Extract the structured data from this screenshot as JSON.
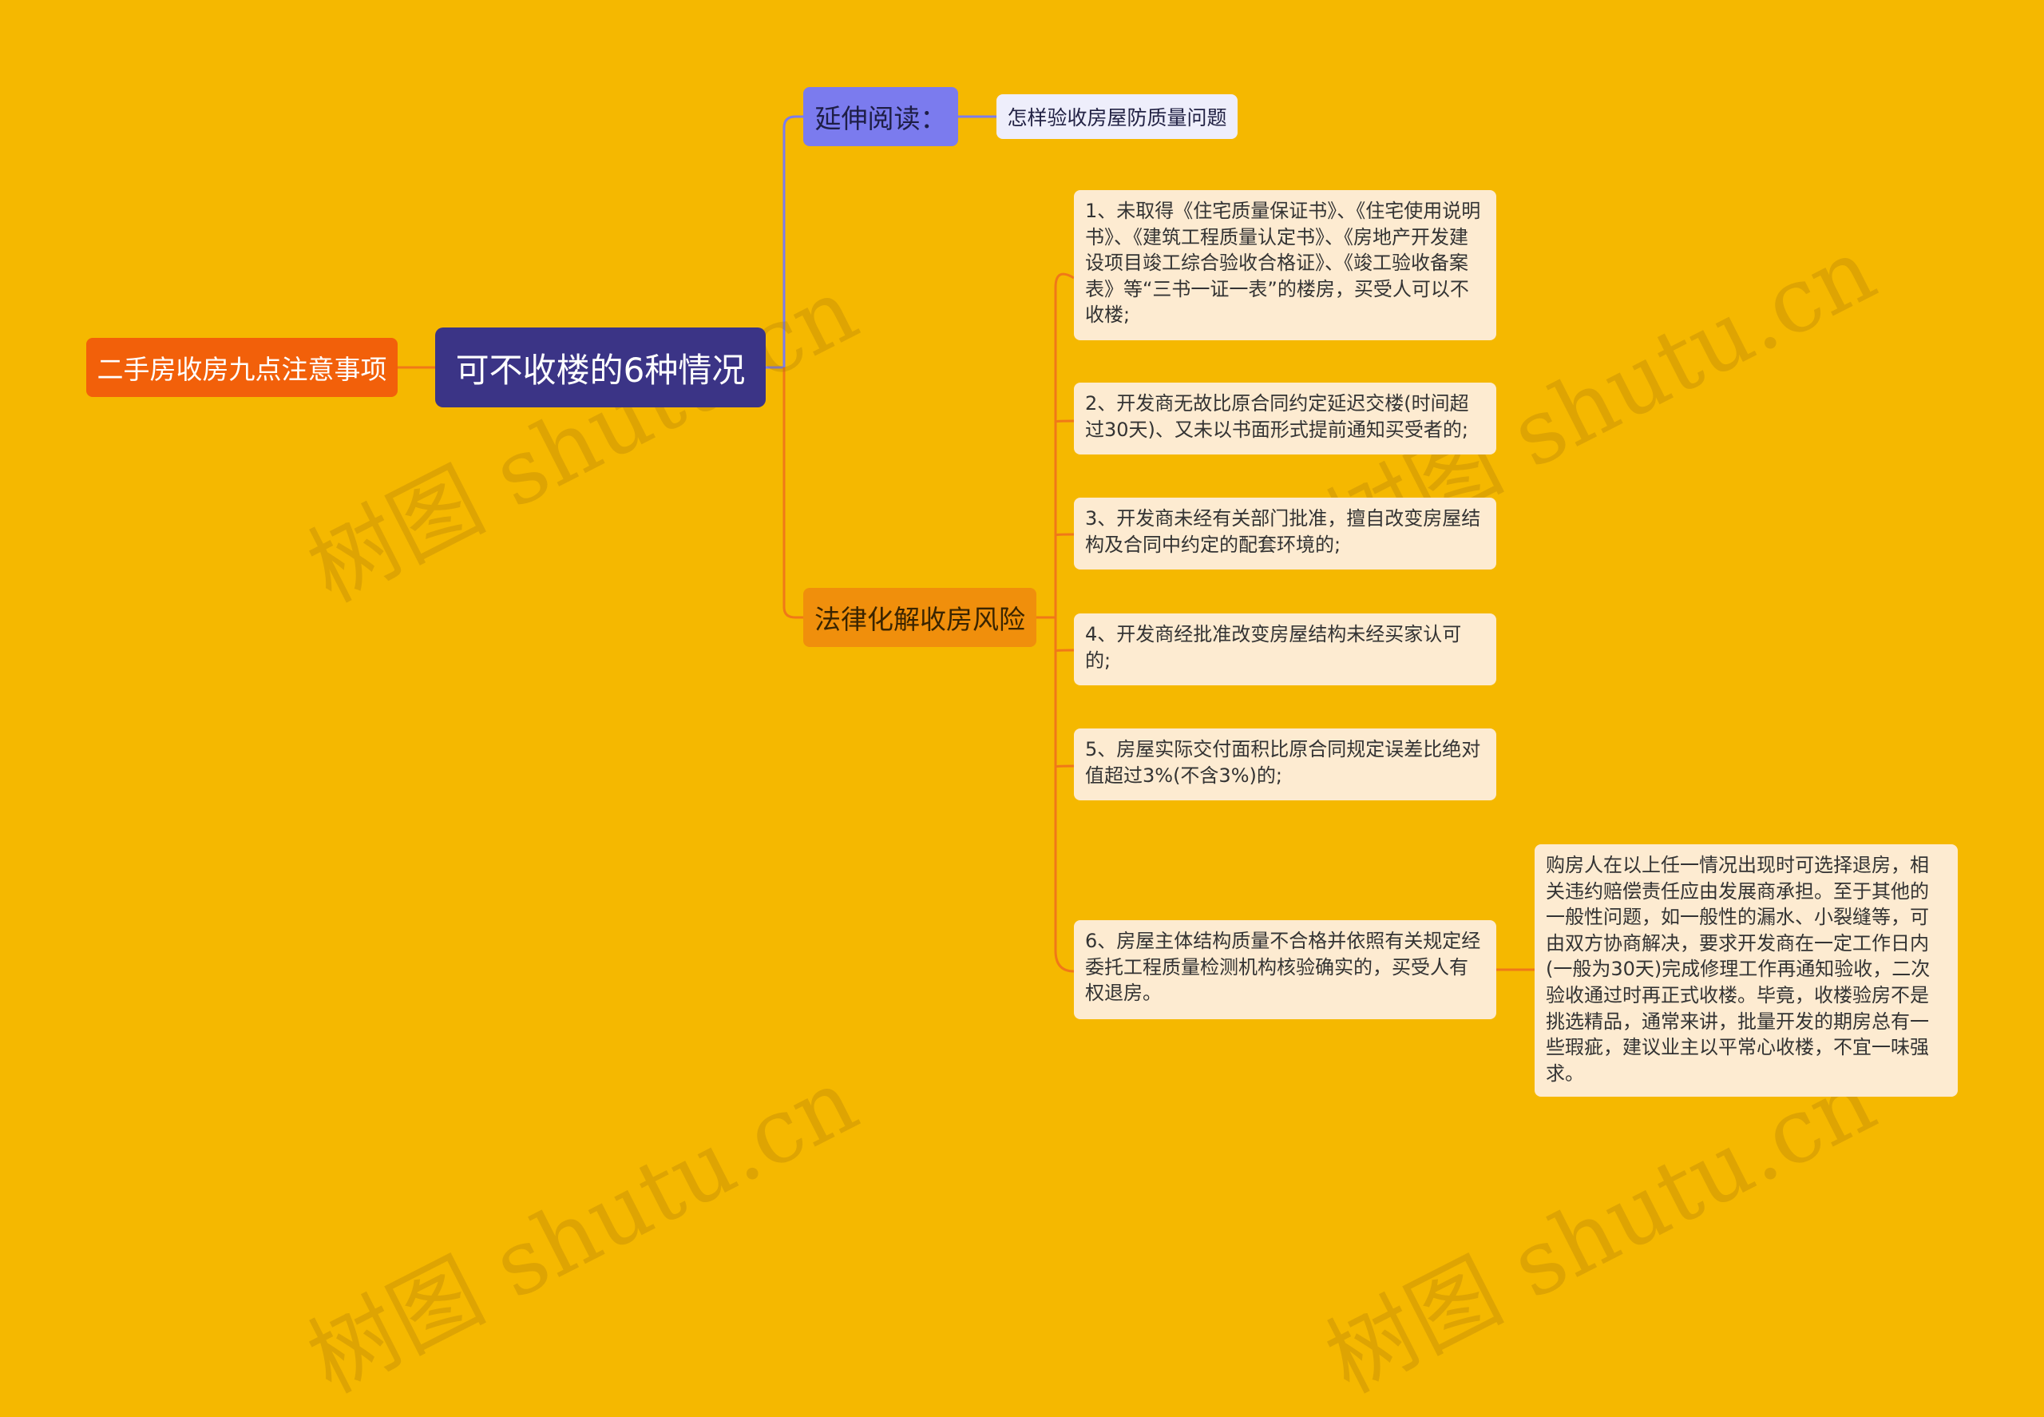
{
  "left_topic": "二手房收房九点注意事项",
  "root_topic": "可不收楼的6种情况",
  "branches": {
    "extended_reading": {
      "label": "延伸阅读：",
      "item": "怎样验收房屋防质量问题"
    },
    "legal": {
      "label": "法律化解收房风险",
      "items": [
        "1、未取得《住宅质量保证书》、《住宅使用说明书》、《建筑工程质量认定书》、《房地产开发建设项目竣工综合验收合格证》、《竣工验收备案表》等“三书一证一表”的楼房，买受人可以不收楼;",
        "2、开发商无故比原合同约定延迟交楼(时间超过30天)、又未以书面形式提前通知买受者的;",
        "3、开发商未经有关部门批准，擅自改变房屋结构及合同中约定的配套环境的;",
        "4、开发商经批准改变房屋结构未经买家认可的;",
        "5、房屋实际交付面积比原合同规定误差比绝对值超过3%(不含3%)的;",
        "6、房屋主体结构质量不合格并依照有关规定经委托工程质量检测机构核验确实的，买受人有权退房。"
      ],
      "note": "购房人在以上任一情况出现时可选择退房，相关违约赔偿责任应由发展商承担。至于其他的一般性问题，如一般性的漏水、小裂缝等，可由双方协商解决，要求开发商在一定工作日内(一般为30天)完成修理工作再通知验收，二次验收通过时再正式收楼。毕竟，收楼验房不是挑选精品，通常来讲，批量开发的期房总有一些瑕疵，建议业主以平常心收楼，不宜一味强求。"
    }
  },
  "watermark": "树图 shutu.cn",
  "colors": {
    "background": "#F5B800",
    "left_topic": "#F2600A",
    "root": "#3B3486",
    "extended_branch": "#7B7BEE",
    "legal_branch": "#F08F0C",
    "leaf": "#FDEBD1",
    "link_extended": "#7B7BEE",
    "link_legal": "#F07818"
  }
}
